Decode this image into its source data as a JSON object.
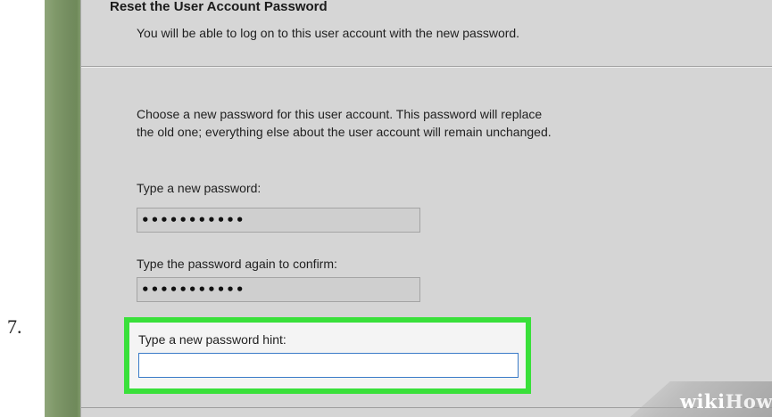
{
  "step": {
    "number": "7."
  },
  "dialog": {
    "title": "Reset the User Account Password",
    "subtitle": "You will be able to log on to this user account with the new password.",
    "description_line1": "Choose a new password for this user account. This password will replace",
    "description_line2": "the old one; everything else about the user account will remain unchanged.",
    "new_password": {
      "label": "Type a new password:",
      "masked_value": "•••••••••••"
    },
    "confirm_password": {
      "label": "Type the password again to confirm:",
      "masked_value": "•••••••••••"
    },
    "password_hint": {
      "label": "Type a new password hint:",
      "value": "",
      "placeholder": ""
    }
  },
  "watermark": {
    "part1": "wiki",
    "part2": "How"
  },
  "colors": {
    "highlight": "#39e03a",
    "dialog_background": "#d5d5d5",
    "desktop_green": "#738c5f",
    "input_focus_border": "#3a7bc8"
  }
}
